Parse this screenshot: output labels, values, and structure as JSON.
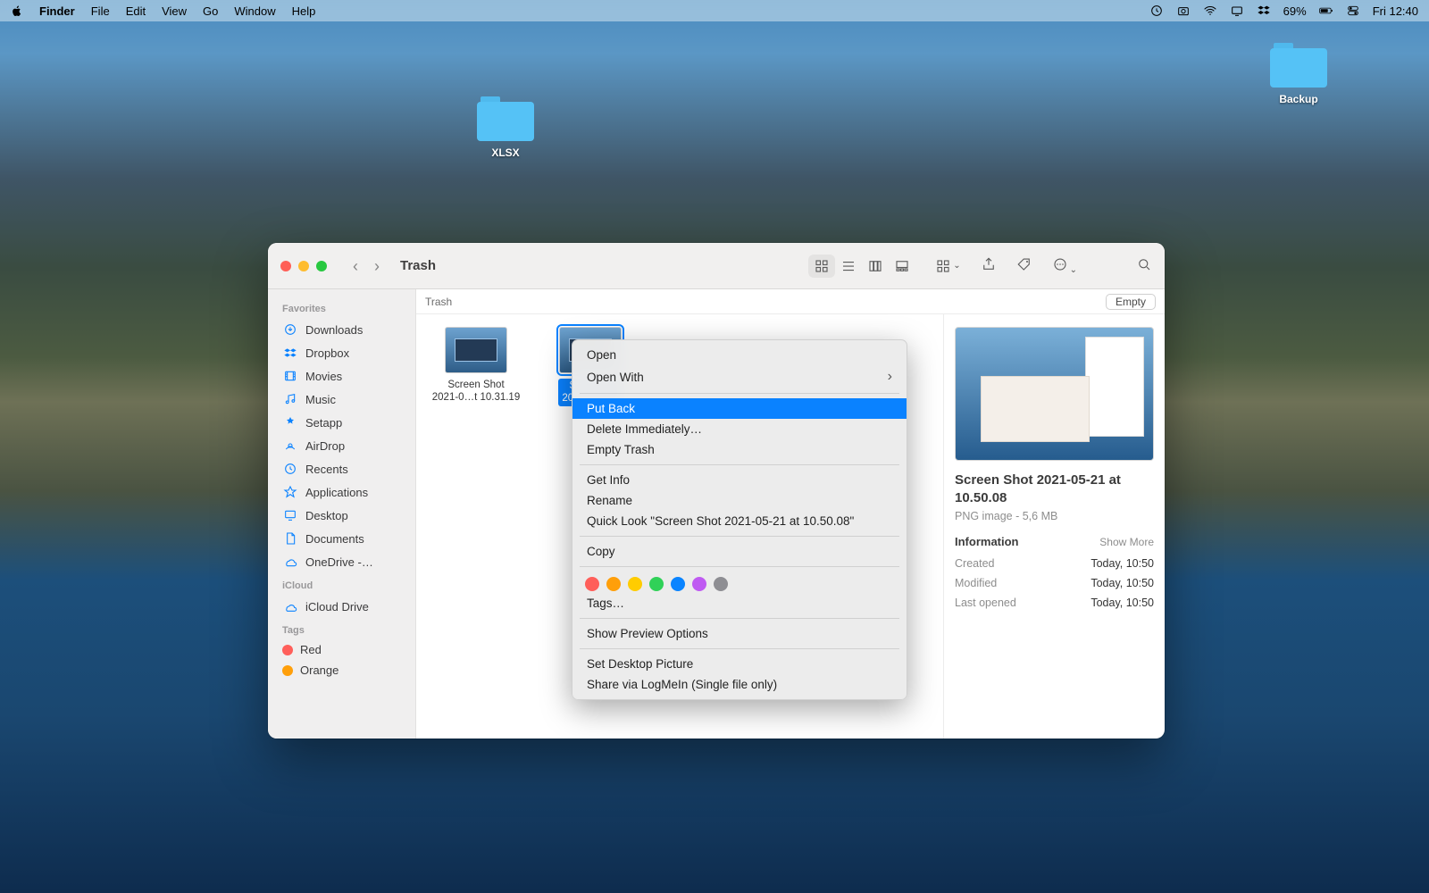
{
  "menubar": {
    "app": "Finder",
    "items": [
      "File",
      "Edit",
      "View",
      "Go",
      "Window",
      "Help"
    ],
    "battery": "69%",
    "clock": "Fri 12:40"
  },
  "desktop": {
    "xlsx": "XLSX",
    "backup": "Backup"
  },
  "finder": {
    "title": "Trash",
    "pathbar": "Trash",
    "empty_button": "Empty",
    "sidebar": {
      "favorites_title": "Favorites",
      "favorites": [
        "Downloads",
        "Dropbox",
        "Movies",
        "Music",
        "Setapp",
        "AirDrop",
        "Recents",
        "Applications",
        "Desktop",
        "Documents",
        "OneDrive -…"
      ],
      "icloud_title": "iCloud",
      "icloud": [
        "iCloud Drive"
      ],
      "tags_title": "Tags",
      "tags": [
        {
          "label": "Red",
          "color": "#ff5f5a"
        },
        {
          "label": "Orange",
          "color": "#ff9f0a"
        }
      ]
    },
    "files": [
      {
        "name_l1": "Screen Shot",
        "name_l2": "2021-0…t 10.31.19",
        "selected": false
      },
      {
        "name_l1": "Screen S",
        "name_l2": "2021-0… 10",
        "selected": true
      }
    ],
    "preview": {
      "title": "Screen Shot 2021-05-21 at 10.50.08",
      "meta": "PNG image - 5,6 MB",
      "info_label": "Information",
      "show_more": "Show More",
      "rows": [
        {
          "k": "Created",
          "v": "Today, 10:50"
        },
        {
          "k": "Modified",
          "v": "Today, 10:50"
        },
        {
          "k": "Last opened",
          "v": "Today, 10:50"
        }
      ]
    }
  },
  "contextmenu": {
    "open": "Open",
    "open_with": "Open With",
    "put_back": "Put Back",
    "delete_immediately": "Delete Immediately…",
    "empty_trash": "Empty Trash",
    "get_info": "Get Info",
    "rename": "Rename",
    "quick_look": "Quick Look \"Screen Shot 2021-05-21 at 10.50.08\"",
    "copy": "Copy",
    "tags_label": "Tags…",
    "tag_colors": [
      "#ff5f5a",
      "#ff9f0a",
      "#ffcc00",
      "#30d158",
      "#0a84ff",
      "#bf5af2",
      "#8e8e93"
    ],
    "show_preview_options": "Show Preview Options",
    "set_desktop_picture": "Set Desktop Picture",
    "share_logmein": "Share via LogMeIn (Single file only)"
  }
}
